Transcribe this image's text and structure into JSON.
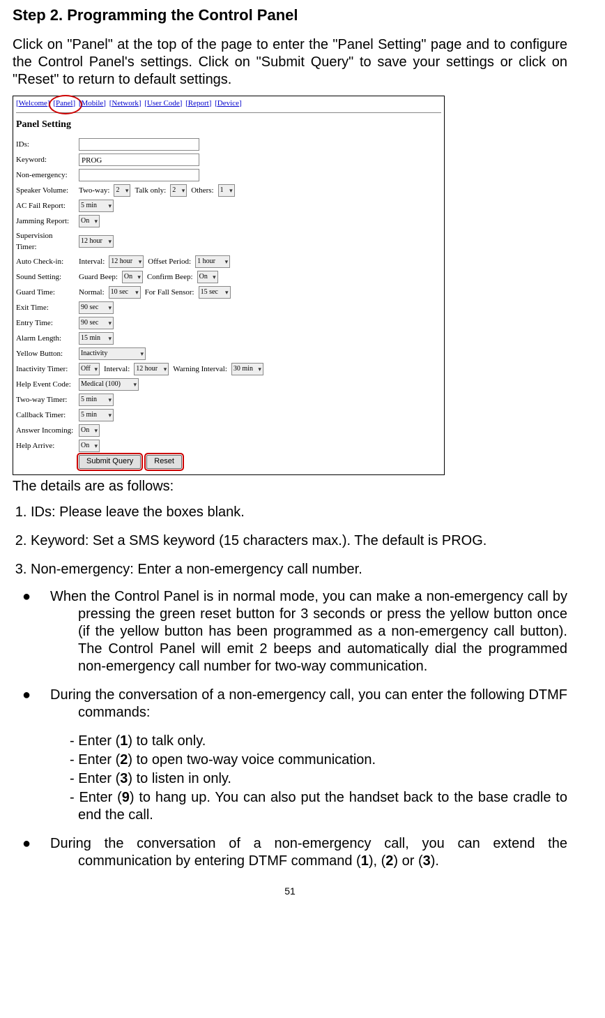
{
  "heading": "Step 2.   Programming the Control Panel",
  "intro": "Click on \"Panel\" at the top of the page to enter the \"Panel Setting\" page and to configure the Control Panel's settings. Click on \"Submit Query\" to save your settings or click on \"Reset\" to return to default settings.",
  "tabs": [
    "[Welcome]",
    "[Panel]",
    "[Mobile]",
    "[Network]",
    "[User Code]",
    "[Report]",
    "[Device]"
  ],
  "panel_title": "Panel Setting",
  "form": {
    "ids_label": "IDs:",
    "keyword_label": "Keyword:",
    "keyword_value": "PROG",
    "nonemerg_label": "Non-emergency:",
    "speaker_label": "Speaker Volume:",
    "speaker_twoway": "Two-way:",
    "speaker_twoway_v": "2",
    "speaker_talk": "Talk only:",
    "speaker_talk_v": "2",
    "speaker_others": "Others:",
    "speaker_others_v": "1",
    "acfail_label": "AC Fail Report:",
    "acfail_v": "5 min",
    "jam_label": "Jamming Report:",
    "jam_v": "On",
    "sup_label": "Supervision Timer:",
    "sup_v": "12 hour",
    "auto_label": "Auto Check-in:",
    "auto_int": "Interval:",
    "auto_int_v": "12 hour",
    "auto_off": "Offset Period:",
    "auto_off_v": "1 hour",
    "sound_label": "Sound Setting:",
    "sound_guard": "Guard Beep:",
    "sound_guard_v": "On",
    "sound_confirm": "Confirm Beep:",
    "sound_confirm_v": "On",
    "guard_label": "Guard Time:",
    "guard_norm": "Normal:",
    "guard_norm_v": "10 sec",
    "guard_fall": "For Fall Sensor:",
    "guard_fall_v": "15 sec",
    "exit_label": "Exit Time:",
    "exit_v": "90 sec",
    "entry_label": "Entry Time:",
    "entry_v": "90 sec",
    "alarm_label": "Alarm Length:",
    "alarm_v": "15 min",
    "yellow_label": "Yellow Button:",
    "yellow_v": "Inactivity",
    "inact_label": "Inactivity Timer:",
    "inact_off": "Off",
    "inact_int": "Interval:",
    "inact_int_v": "12 hour",
    "inact_warn": "Warning Interval:",
    "inact_warn_v": "30 min",
    "help_label": "Help Event Code:",
    "help_v": "Medical (100)",
    "twoway_label": "Two-way Timer:",
    "twoway_v": "5 min",
    "callback_label": "Callback Timer:",
    "callback_v": "5 min",
    "answer_label": "Answer Incoming:",
    "answer_v": "On",
    "arrive_label": "Help Arrive:",
    "arrive_v": "On",
    "submit_btn": "Submit Query",
    "reset_btn": "Reset"
  },
  "caption": "The details are as follows:",
  "items": {
    "i1": "IDs: Please leave the boxes blank.",
    "i2": "Keyword: Set a SMS keyword (15 characters max.). The default is PROG.",
    "i3": "Non-emergency: Enter a non-emergency call number."
  },
  "bullets": {
    "b1": "When the Control Panel is in normal mode, you can make a non-emergency call by pressing the green reset button for 3 seconds or press the yellow button once (if the yellow button has been programmed as a non-emergency call button). The Control Panel will emit 2 beeps and automatically dial the programmed non-emergency call number for two-way communication.",
    "b2": "During the conversation of a non-emergency call, you can enter the following DTMF commands:",
    "b3_pre": "During the conversation of a non-emergency call, you can extend the communication by entering DTMF command (",
    "b3_a": "1",
    "b3_b": "2",
    "b3_c": "3",
    "b3_post": ")."
  },
  "dashes": {
    "d1_pre": "Enter (",
    "d1_key": "1",
    "d1_post": ") to talk only.",
    "d2_pre": "Enter (",
    "d2_key": "2",
    "d2_post": ") to open two-way voice communication.",
    "d3_pre": "Enter (",
    "d3_key": "3",
    "d3_post": ") to listen in only.",
    "d4_pre": "Enter (",
    "d4_key": "9",
    "d4_post": ") to hang up. You can also put the handset back to the base cradle to end the call."
  },
  "pagenum": "51"
}
